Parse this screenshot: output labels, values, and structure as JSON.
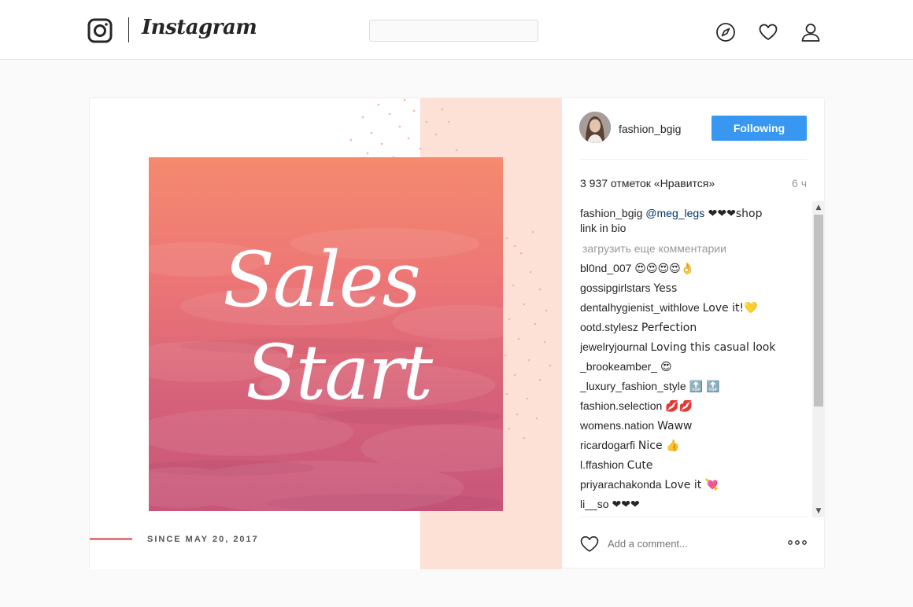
{
  "app": {
    "wordmark": "Instagram",
    "search_placeholder": ""
  },
  "nav": {
    "icons": [
      "compass-icon",
      "heart-icon",
      "profile-icon"
    ]
  },
  "post": {
    "image_text": {
      "line1": "Sales",
      "line2": "Start"
    },
    "since_text": "SINCE MAY 20, 2017",
    "colors": {
      "accent_line": "#e57c7c",
      "peach_band": "#fde1d6",
      "follow_button": "#3897f0"
    }
  },
  "author": {
    "username": "fashion_bgig",
    "follow_label": "Following"
  },
  "stats": {
    "likes": "3 937 отметок «Нравится»",
    "age": "6 ч"
  },
  "caption": {
    "user": "fashion_bgig",
    "mention": "@meg_legs",
    "text_after_mention": " ❤❤❤shop",
    "text_line2": "link in bio"
  },
  "load_more": "загрузить еще комментарии",
  "comments": [
    {
      "user": "bl0nd_007",
      "text": "😍😍😍😍👌"
    },
    {
      "user": "gossipgirlstars",
      "text": "Yess"
    },
    {
      "user": "dentalhygienist_withlove",
      "text": "Love it!💛"
    },
    {
      "user": "ootd.stylesz",
      "text": "Perfection"
    },
    {
      "user": "jewelryjournal",
      "text": "Loving this casual look"
    },
    {
      "user": "_brookeamber_",
      "text": "😍"
    },
    {
      "user": "_luxury_fashion_style",
      "text": "🔝 🔝"
    },
    {
      "user": "fashion.selection",
      "text": "💋💋"
    },
    {
      "user": "womens.nation",
      "text": "Waww"
    },
    {
      "user": "ricardogarfi",
      "text": "Nice 👍"
    },
    {
      "user": "l.ffashion",
      "text": "Cute"
    },
    {
      "user": "priyarachakonda",
      "text": "Love it 💘"
    },
    {
      "user": "li__so",
      "text": "❤❤❤"
    }
  ],
  "composer": {
    "placeholder": "Add a comment..."
  }
}
